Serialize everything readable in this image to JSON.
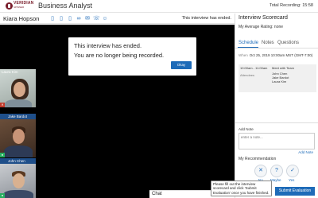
{
  "header": {
    "logo_text": "VERIDIAN",
    "logo_sub": "SPINNER",
    "job_title": "Business Analyst",
    "recording": "Total Recording: 15:58"
  },
  "candidate": {
    "name": "Kiara Hopson",
    "ended_note": "This interview has ended."
  },
  "modal": {
    "line1": "This interview has ended.",
    "line2": "You are no longer being recorded.",
    "ok_label": "Okay"
  },
  "participants": [
    {
      "name": "Laura Kim",
      "status": "muted"
    },
    {
      "name": "Jake Bardot",
      "status": "active"
    },
    {
      "name": "John Chen",
      "status": "active"
    }
  ],
  "chat": {
    "label": "Chat"
  },
  "scorecard": {
    "title": "Interview Scorecard",
    "avg_rating": "My Average Rating: none",
    "tabs": [
      "Schedule",
      "Notes",
      "Questions"
    ],
    "when_label": "When",
    "when_value": "Oct 25, 2019 10:00am MST (GMT-7:00)",
    "schedule": {
      "time": "10:00am - 11:00am",
      "event": "Meet with Team",
      "attendees_label": "Attendees",
      "attendees": [
        "John Chen",
        "Jake Bardot",
        "Laura Kim"
      ]
    },
    "add_note_label": "Add Note",
    "note_placeholder": "enter a note...",
    "add_note_link": "Add Note",
    "recommendation_label": "My Recommendation",
    "recommendation_options": [
      "No",
      "Maybe",
      "Yes"
    ],
    "submit_label": "Submit Evaluation"
  },
  "tooltip": {
    "text": "Please fill out the interview scorecard and click 'Submit Evaluation' once you have finished."
  },
  "colors": {
    "brand": "#7a1e2c",
    "accent": "#1e6bb8",
    "muted_status": "#c0392b",
    "active_status": "#27ae60"
  }
}
